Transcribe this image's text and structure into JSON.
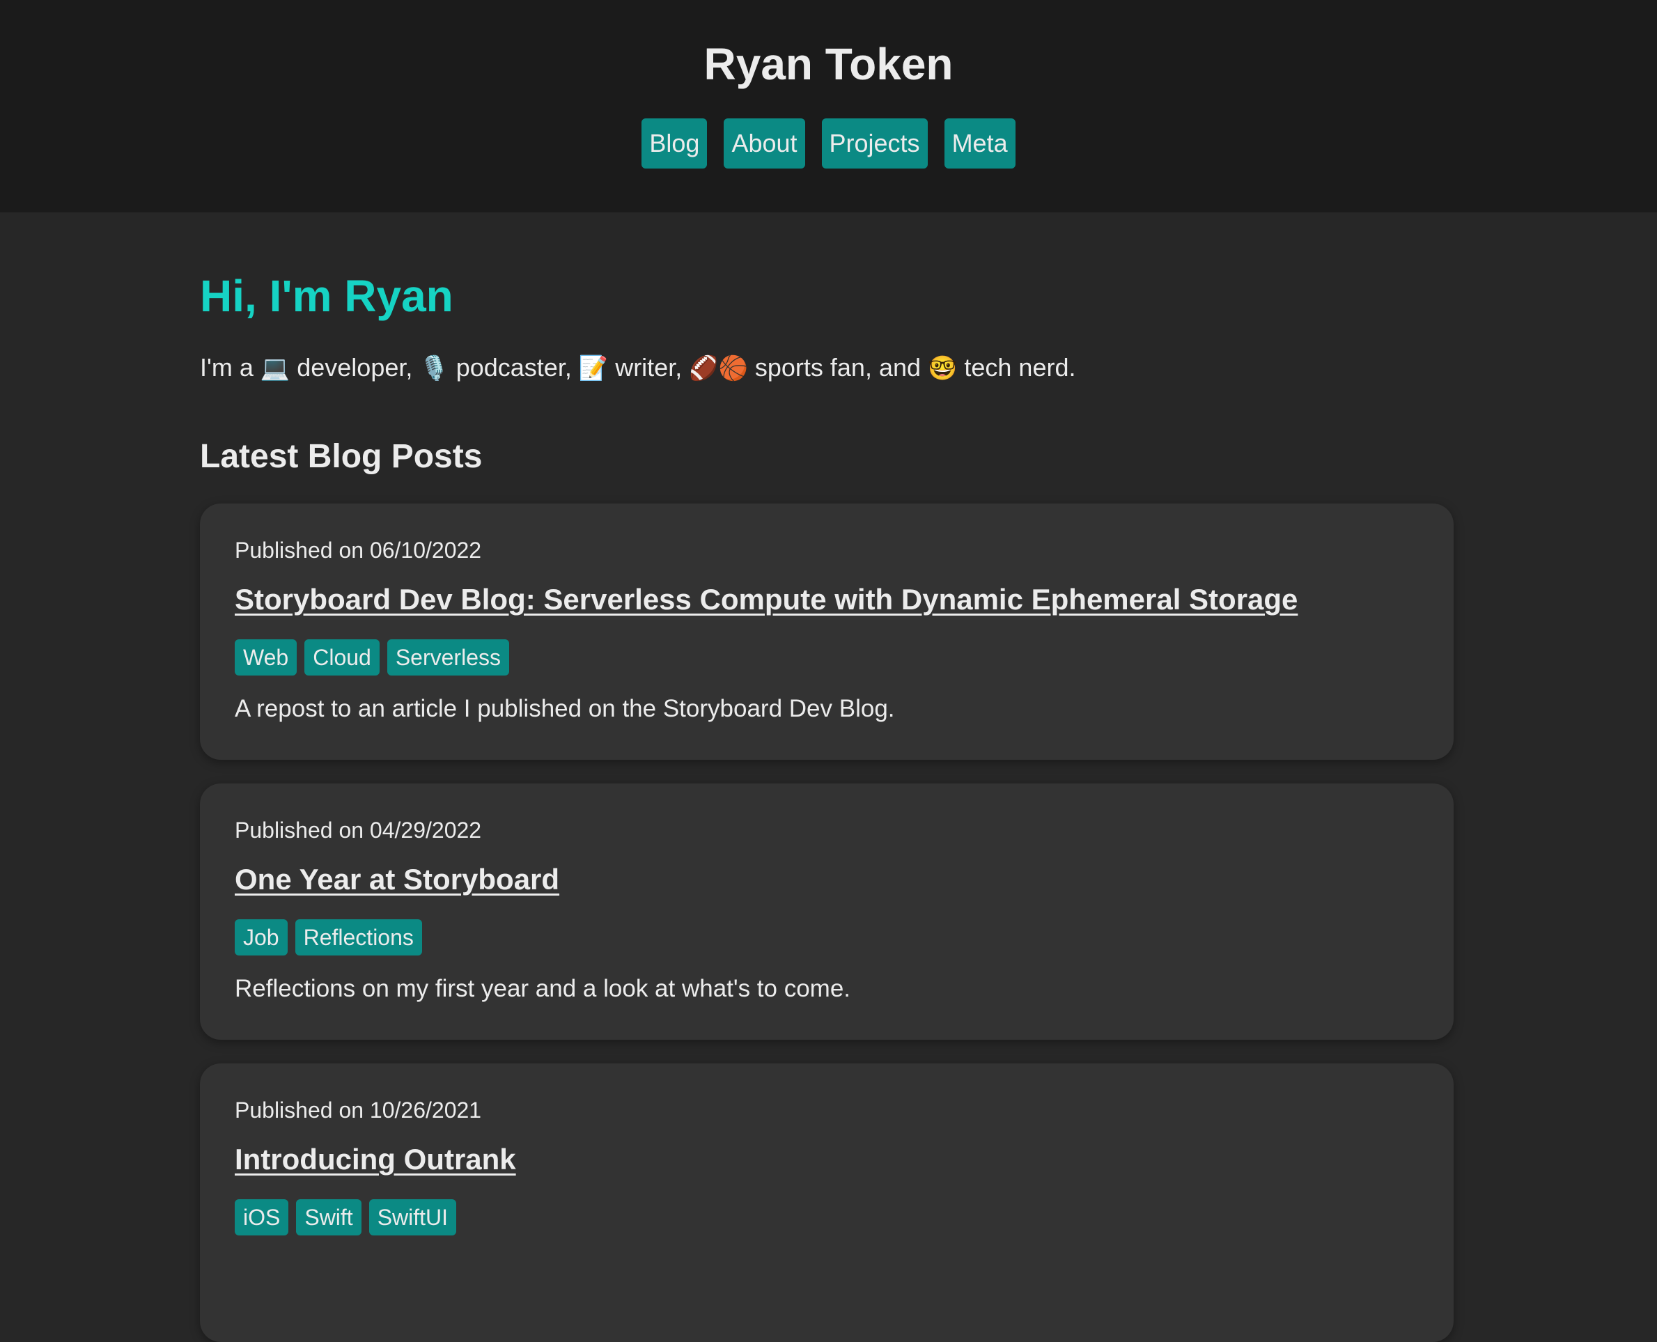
{
  "header": {
    "site_title": "Ryan Token",
    "nav": [
      {
        "label": "Blog"
      },
      {
        "label": "About"
      },
      {
        "label": "Projects"
      },
      {
        "label": "Meta"
      }
    ]
  },
  "hero": {
    "title": "Hi, I'm Ryan",
    "intro": {
      "p1": "I'm a ",
      "e1": "💻",
      "p2": " developer, ",
      "e2": "🎙️",
      "p3": " podcaster, ",
      "e3": "📝",
      "p4": " writer, ",
      "e4": "🏈🏀",
      "p5": " sports fan, and ",
      "e5": "🤓",
      "p6": " tech nerd."
    }
  },
  "posts_section": {
    "title": "Latest Blog Posts",
    "posts": [
      {
        "date": "Published on 06/10/2022",
        "title": "Storyboard Dev Blog: Serverless Compute with Dynamic Ephemeral Storage",
        "tags": [
          "Web",
          "Cloud",
          "Serverless"
        ],
        "description": "A repost to an article I published on the Storyboard Dev Blog."
      },
      {
        "date": "Published on 04/29/2022",
        "title": "One Year at Storyboard",
        "tags": [
          "Job",
          "Reflections"
        ],
        "description": "Reflections on my first year and a look at what's to come."
      },
      {
        "date": "Published on 10/26/2021",
        "title": "Introducing Outrank",
        "tags": [
          "iOS",
          "Swift",
          "SwiftUI"
        ],
        "description": ""
      }
    ]
  },
  "colors": {
    "header_bg": "#1b1b1b",
    "page_bg": "#272727",
    "card_bg": "#333333",
    "accent": "#0b8a84",
    "hero_title": "#16d3c4",
    "text": "#ececec"
  }
}
